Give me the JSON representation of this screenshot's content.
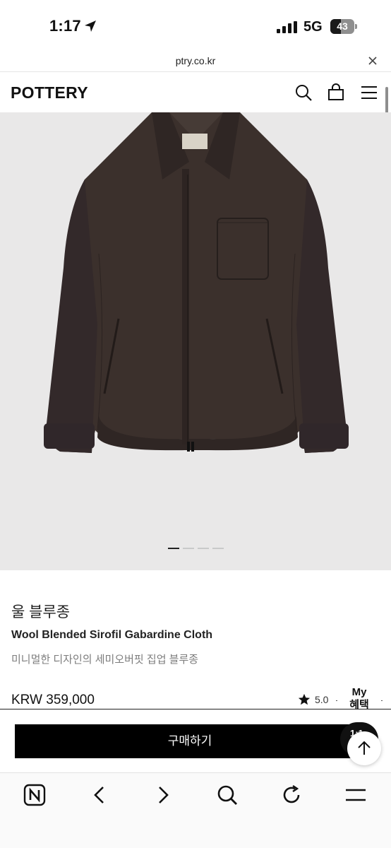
{
  "status_bar": {
    "time": "1:17",
    "network": "5G",
    "battery": "43",
    "battery_level": 0.43,
    "icons": [
      "location-arrow-icon",
      "signal-bars-icon",
      "battery-icon"
    ]
  },
  "url_bar": {
    "url": "ptry.co.kr",
    "close_icon": "close-icon"
  },
  "header": {
    "logo": "POTTERY",
    "icons": [
      "search-icon",
      "shopping-bag-icon",
      "hamburger-menu-icon"
    ]
  },
  "product": {
    "image_bg": "#e9e8e8",
    "carousel": {
      "total": 4,
      "active": 1
    },
    "name_kr": "울 블루종",
    "name_en": "Wool Blended Sirofil Gabardine Cloth",
    "description": "미니멀한 디자인의 세미오버핏 집업 블루종",
    "price": "KRW 359,000",
    "rating": "5.0",
    "rating_icon": "star-icon"
  },
  "my_benefit": {
    "line1": "My",
    "line2": "혜택"
  },
  "buy": {
    "button_label": "구매하기",
    "chat_badge": "1:1",
    "scroll_top_icon": "arrow-up-icon"
  },
  "colors": {
    "buy_button_bg": "#000000",
    "jacket": "#3b302c",
    "text_muted": "#7d7d7d"
  },
  "browser_toolbar": {
    "items": [
      "naver-home-icon",
      "back-arrow-icon",
      "forward-arrow-icon",
      "search-icon",
      "refresh-icon",
      "menu-icon"
    ]
  }
}
